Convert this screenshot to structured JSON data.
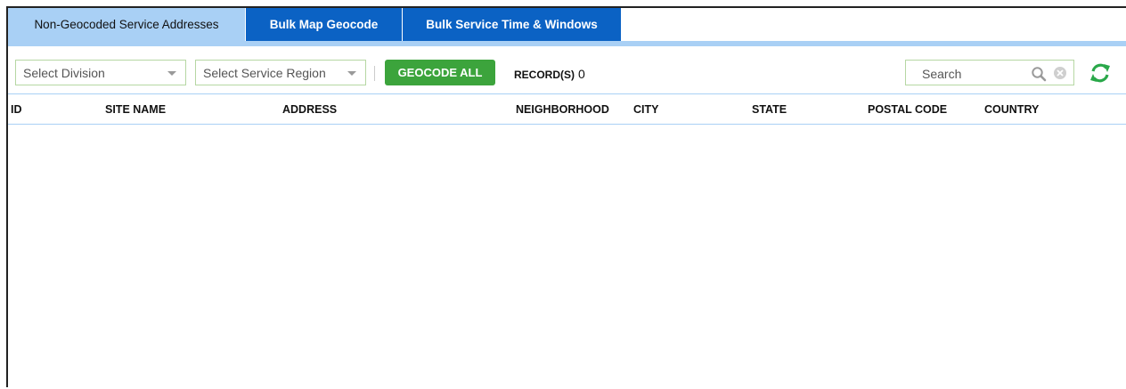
{
  "tabs": [
    {
      "label": "Non-Geocoded Service Addresses"
    },
    {
      "label": "Bulk Map Geocode"
    },
    {
      "label": "Bulk Service Time & Windows"
    }
  ],
  "toolbar": {
    "division_select": "Select Division",
    "region_select": "Select Service Region",
    "geocode_all_label": "GEOCODE ALL",
    "records_label": "RECORD(S)",
    "records_count": "0",
    "search_placeholder": "Search"
  },
  "table": {
    "columns": [
      "ID",
      "SITE NAME",
      "ADDRESS",
      "NEIGHBORHOOD",
      "CITY",
      "STATE",
      "POSTAL CODE",
      "COUNTRY"
    ],
    "rows": []
  },
  "colors": {
    "active_tab": "#a9d0f5",
    "tab_blue": "#0b62c4",
    "geocode_green": "#3ca43c",
    "input_border": "#b6d7a3",
    "refresh_green": "#2aa84a"
  },
  "icons": [
    "chevron-down-icon",
    "search-icon",
    "clear-icon",
    "refresh-icon"
  ]
}
